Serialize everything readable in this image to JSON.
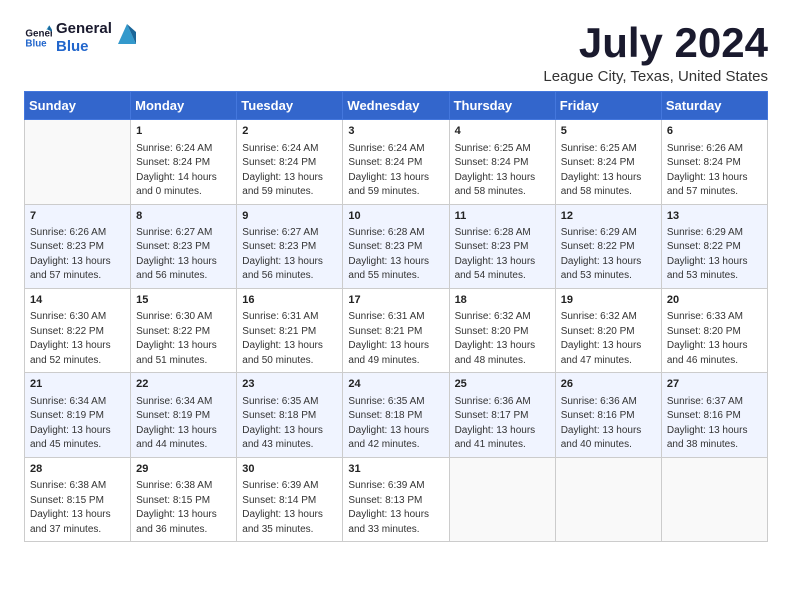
{
  "logo": {
    "line1": "General",
    "line2": "Blue"
  },
  "title": "July 2024",
  "subtitle": "League City, Texas, United States",
  "days_of_week": [
    "Sunday",
    "Monday",
    "Tuesday",
    "Wednesday",
    "Thursday",
    "Friday",
    "Saturday"
  ],
  "weeks": [
    [
      {
        "day": "",
        "info": ""
      },
      {
        "day": "1",
        "info": "Sunrise: 6:24 AM\nSunset: 8:24 PM\nDaylight: 14 hours\nand 0 minutes."
      },
      {
        "day": "2",
        "info": "Sunrise: 6:24 AM\nSunset: 8:24 PM\nDaylight: 13 hours\nand 59 minutes."
      },
      {
        "day": "3",
        "info": "Sunrise: 6:24 AM\nSunset: 8:24 PM\nDaylight: 13 hours\nand 59 minutes."
      },
      {
        "day": "4",
        "info": "Sunrise: 6:25 AM\nSunset: 8:24 PM\nDaylight: 13 hours\nand 58 minutes."
      },
      {
        "day": "5",
        "info": "Sunrise: 6:25 AM\nSunset: 8:24 PM\nDaylight: 13 hours\nand 58 minutes."
      },
      {
        "day": "6",
        "info": "Sunrise: 6:26 AM\nSunset: 8:24 PM\nDaylight: 13 hours\nand 57 minutes."
      }
    ],
    [
      {
        "day": "7",
        "info": "Sunrise: 6:26 AM\nSunset: 8:23 PM\nDaylight: 13 hours\nand 57 minutes."
      },
      {
        "day": "8",
        "info": "Sunrise: 6:27 AM\nSunset: 8:23 PM\nDaylight: 13 hours\nand 56 minutes."
      },
      {
        "day": "9",
        "info": "Sunrise: 6:27 AM\nSunset: 8:23 PM\nDaylight: 13 hours\nand 56 minutes."
      },
      {
        "day": "10",
        "info": "Sunrise: 6:28 AM\nSunset: 8:23 PM\nDaylight: 13 hours\nand 55 minutes."
      },
      {
        "day": "11",
        "info": "Sunrise: 6:28 AM\nSunset: 8:23 PM\nDaylight: 13 hours\nand 54 minutes."
      },
      {
        "day": "12",
        "info": "Sunrise: 6:29 AM\nSunset: 8:22 PM\nDaylight: 13 hours\nand 53 minutes."
      },
      {
        "day": "13",
        "info": "Sunrise: 6:29 AM\nSunset: 8:22 PM\nDaylight: 13 hours\nand 53 minutes."
      }
    ],
    [
      {
        "day": "14",
        "info": "Sunrise: 6:30 AM\nSunset: 8:22 PM\nDaylight: 13 hours\nand 52 minutes."
      },
      {
        "day": "15",
        "info": "Sunrise: 6:30 AM\nSunset: 8:22 PM\nDaylight: 13 hours\nand 51 minutes."
      },
      {
        "day": "16",
        "info": "Sunrise: 6:31 AM\nSunset: 8:21 PM\nDaylight: 13 hours\nand 50 minutes."
      },
      {
        "day": "17",
        "info": "Sunrise: 6:31 AM\nSunset: 8:21 PM\nDaylight: 13 hours\nand 49 minutes."
      },
      {
        "day": "18",
        "info": "Sunrise: 6:32 AM\nSunset: 8:20 PM\nDaylight: 13 hours\nand 48 minutes."
      },
      {
        "day": "19",
        "info": "Sunrise: 6:32 AM\nSunset: 8:20 PM\nDaylight: 13 hours\nand 47 minutes."
      },
      {
        "day": "20",
        "info": "Sunrise: 6:33 AM\nSunset: 8:20 PM\nDaylight: 13 hours\nand 46 minutes."
      }
    ],
    [
      {
        "day": "21",
        "info": "Sunrise: 6:34 AM\nSunset: 8:19 PM\nDaylight: 13 hours\nand 45 minutes."
      },
      {
        "day": "22",
        "info": "Sunrise: 6:34 AM\nSunset: 8:19 PM\nDaylight: 13 hours\nand 44 minutes."
      },
      {
        "day": "23",
        "info": "Sunrise: 6:35 AM\nSunset: 8:18 PM\nDaylight: 13 hours\nand 43 minutes."
      },
      {
        "day": "24",
        "info": "Sunrise: 6:35 AM\nSunset: 8:18 PM\nDaylight: 13 hours\nand 42 minutes."
      },
      {
        "day": "25",
        "info": "Sunrise: 6:36 AM\nSunset: 8:17 PM\nDaylight: 13 hours\nand 41 minutes."
      },
      {
        "day": "26",
        "info": "Sunrise: 6:36 AM\nSunset: 8:16 PM\nDaylight: 13 hours\nand 40 minutes."
      },
      {
        "day": "27",
        "info": "Sunrise: 6:37 AM\nSunset: 8:16 PM\nDaylight: 13 hours\nand 38 minutes."
      }
    ],
    [
      {
        "day": "28",
        "info": "Sunrise: 6:38 AM\nSunset: 8:15 PM\nDaylight: 13 hours\nand 37 minutes."
      },
      {
        "day": "29",
        "info": "Sunrise: 6:38 AM\nSunset: 8:15 PM\nDaylight: 13 hours\nand 36 minutes."
      },
      {
        "day": "30",
        "info": "Sunrise: 6:39 AM\nSunset: 8:14 PM\nDaylight: 13 hours\nand 35 minutes."
      },
      {
        "day": "31",
        "info": "Sunrise: 6:39 AM\nSunset: 8:13 PM\nDaylight: 13 hours\nand 33 minutes."
      },
      {
        "day": "",
        "info": ""
      },
      {
        "day": "",
        "info": ""
      },
      {
        "day": "",
        "info": ""
      }
    ]
  ]
}
